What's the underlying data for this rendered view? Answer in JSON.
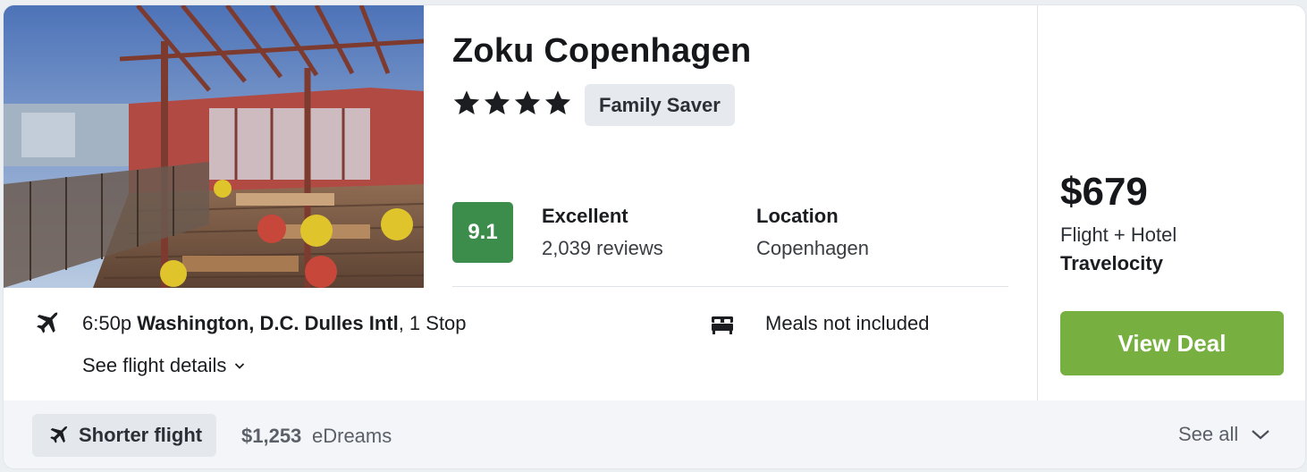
{
  "hotel": {
    "name": "Zoku Copenhagen",
    "star_rating": 4,
    "badge": "Family Saver",
    "score": "9.1",
    "rating_label": "Excellent",
    "reviews": "2,039 reviews",
    "location_label": "Location",
    "location_value": "Copenhagen",
    "photo_icon": "hotel-terrace-photo"
  },
  "flight": {
    "icon": "airplane-icon",
    "time": "6:50p",
    "airport": "Washington, D.C. Dulles Intl",
    "stops": ", 1 Stop",
    "details_link": "See flight details"
  },
  "amenity": {
    "icon": "bed-icon",
    "meals": "Meals not included"
  },
  "deal": {
    "price": "$679",
    "package": "Flight + Hotel",
    "provider": "Travelocity",
    "button": "View Deal",
    "button_color": "#77b041"
  },
  "footer": {
    "chip_label": "Shorter flight",
    "alt_price": "$1,253",
    "alt_provider": "eDreams",
    "see_all": "See all"
  },
  "colors": {
    "score_bg": "#3c8d4c",
    "badge_bg": "#e6e9ed"
  }
}
